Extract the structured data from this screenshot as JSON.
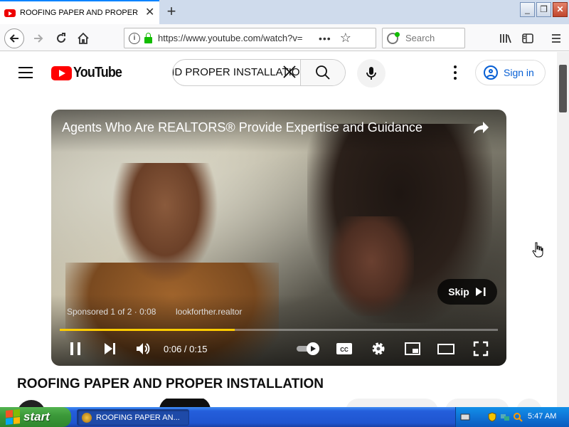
{
  "browser": {
    "tab_title": "ROOFING PAPER AND PROPER INSTALLATION - YouTube",
    "url": "https://www.youtube.com/watch?v=",
    "search_placeholder": "Search"
  },
  "youtube": {
    "logo_text": "YouTube",
    "search_value": "ROOFING PAPER AND PROPER INSTALLATIO",
    "sign_in_label": "Sign in"
  },
  "video": {
    "ad_title": "Agents Who Are REALTORS® Provide Expertise and Guidance",
    "skip_label": "Skip",
    "sponsored_text": "Sponsored 1 of 2 · 0:08",
    "advertiser_url": "lookforther.realtor",
    "time_display": "0:06 / 0:15",
    "progress_fraction": 0.4,
    "accent_color": "#ffcc00"
  },
  "page": {
    "video_title": "ROOFING PAPER AND PROPER INSTALLATION"
  },
  "taskbar": {
    "start_label": "start",
    "task_item": "ROOFING PAPER AN...",
    "clock": "5:47 AM"
  }
}
